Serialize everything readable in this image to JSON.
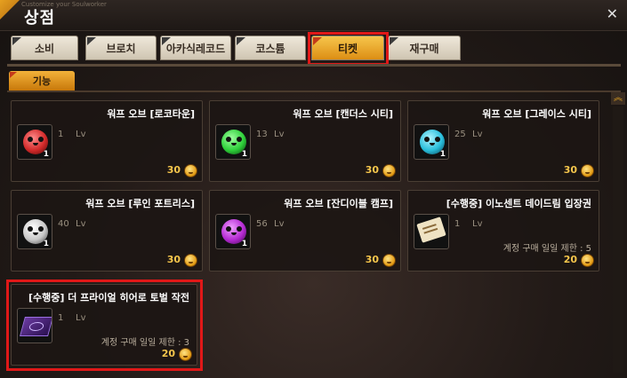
{
  "window": {
    "small_caption": "Customize your Soulworker",
    "title": "상점",
    "close_glyph": "✕"
  },
  "tabs": [
    {
      "label": "소비",
      "active": false
    },
    {
      "label": "브로치",
      "active": false
    },
    {
      "label": "아카식레코드",
      "active": false
    },
    {
      "label": "코스튬",
      "active": false
    },
    {
      "label": "티켓",
      "active": true
    },
    {
      "label": "재구매",
      "active": false
    }
  ],
  "subtab": {
    "label": "기능"
  },
  "scroll_up_glyph": "︽",
  "items": [
    {
      "name": "워프 오브 [로코타운]",
      "qty": "1",
      "level_value": "1",
      "level_unit": "Lv",
      "limit": "",
      "price": "30",
      "icon": "orb-red-icon",
      "orb_color": "#d22a2a"
    },
    {
      "name": "워프 오브 [캔더스 시티]",
      "qty": "1",
      "level_value": "13",
      "level_unit": "Lv",
      "limit": "",
      "price": "30",
      "icon": "orb-green-icon",
      "orb_color": "#2ecf3a"
    },
    {
      "name": "워프 오브 [그레이스 시티]",
      "qty": "1",
      "level_value": "25",
      "level_unit": "Lv",
      "limit": "",
      "price": "30",
      "icon": "orb-cyan-icon",
      "orb_color": "#2abfdc"
    },
    {
      "name": "워프 오브 [루인 포트리스]",
      "qty": "1",
      "level_value": "40",
      "level_unit": "Lv",
      "limit": "",
      "price": "30",
      "icon": "orb-white-icon",
      "orb_color": "#c8c8c8"
    },
    {
      "name": "워프 오브 [잔디이블 캠프]",
      "qty": "1",
      "level_value": "56",
      "level_unit": "Lv",
      "limit": "",
      "price": "30",
      "icon": "orb-purple-icon",
      "orb_color": "#b42ad2"
    },
    {
      "name": "[수행중] 이노센트 데이드림 입장권",
      "qty": "",
      "level_value": "1",
      "level_unit": "Lv",
      "limit": "계정 구매 일일 제한 : 5",
      "price": "20",
      "icon": "scroll-ticket-icon",
      "orb_color": ""
    },
    {
      "name": "[수행중] 더 프라이얼 히어로 토벌 작전",
      "qty": "",
      "level_value": "1",
      "level_unit": "Lv",
      "limit": "계정 구매 일일 제한 : 3",
      "price": "20",
      "icon": "purple-ticket-icon",
      "orb_color": ""
    }
  ],
  "colors": {
    "highlight": "#e01818",
    "accent": "#f6c64c"
  }
}
